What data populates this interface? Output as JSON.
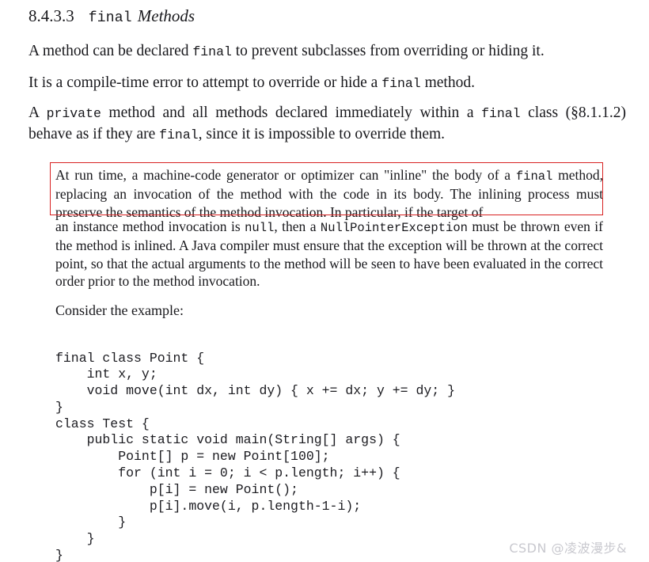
{
  "heading": {
    "number": "8.4.3.3",
    "keyword": "final",
    "title": "Methods"
  },
  "paragraphs": {
    "p1": {
      "a": "A method can be declared ",
      "code1": "final",
      "b": " to prevent subclasses from overriding or hiding it."
    },
    "p2": {
      "a": "It is a compile-time error to attempt to override or hide a ",
      "code1": "final",
      "b": " method."
    },
    "p3": {
      "a": "A ",
      "code1": "private",
      "b": " method and all methods declared immediately within a ",
      "code2": "final",
      "c": " class (§8.1.1.2) behave as if they are ",
      "code3": "final",
      "d": ", since it is impossible to override them."
    }
  },
  "note": {
    "highlighted": {
      "a": "At run time, a machine-code generator or optimizer can \"inline\" the body of a ",
      "code1": "final",
      "b": " method, replacing an invocation of the method with the code in its body. The inlining process must preserve the semantics of the method invocation. In particular, if the target of"
    },
    "rest": {
      "a": "an instance method invocation is ",
      "code1": "null",
      "b": ", then a ",
      "code2": "NullPointerException",
      "c": " must be thrown even if the method is inlined. A Java compiler must ensure that the exception will be thrown at the correct point, so that the actual arguments to the method will be seen to have been evaluated in the correct order prior to the method invocation."
    }
  },
  "consider_label": "Consider the example:",
  "code_example": "final class Point {\n    int x, y;\n    void move(int dx, int dy) { x += dx; y += dy; }\n}\nclass Test {\n    public static void main(String[] args) {\n        Point[] p = new Point[100];\n        for (int i = 0; i < p.length; i++) {\n            p[i] = new Point();\n            p[i].move(i, p.length-1-i);\n        }\n    }\n}",
  "watermark": "CSDN @凌波漫步&",
  "colors": {
    "highlight_border": "#d82222",
    "text": "#18181c",
    "watermark": "#c9c9cf",
    "page_background": "#ffffff"
  }
}
